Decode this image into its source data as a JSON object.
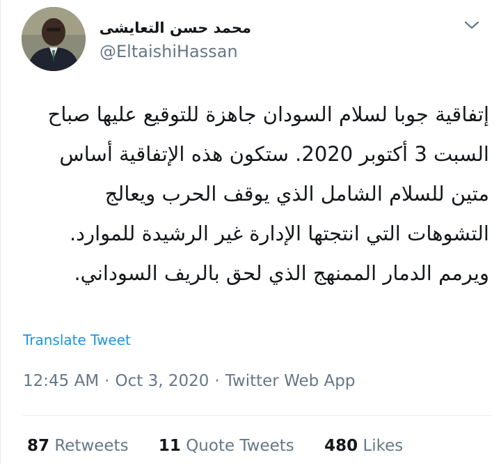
{
  "tweet": {
    "author": {
      "display_name": "محمد حسن التعايشى",
      "handle": "@EltaishiHassan",
      "avatar_icon": "profile-photo"
    },
    "menu_icon": "chevron-down-icon",
    "text": "إتفاقية جوبا لسلام السودان جاهزة للتوقيع عليها صباح السبت 3 أكتوبر 2020. ستكون هذه الإتفاقية أساس متين للسلام الشامل الذي يوقف الحرب ويعالج التشوهات التي انتجتها الإدارة غير الرشيدة للموارد. ويرمم الدمار الممنهج الذي لحق بالريف السوداني.",
    "translate_label": "Translate Tweet",
    "time": "12:45 AM",
    "date": "Oct 3, 2020",
    "source": "Twitter Web App",
    "separator": "·",
    "stats": {
      "retweets_count": "87",
      "retweets_label": "Retweets",
      "quote_count": "11",
      "quote_label": "Quote Tweets",
      "likes_count": "480",
      "likes_label": "Likes"
    }
  },
  "colors": {
    "link": "#1b95e0",
    "secondary_text": "#657786",
    "primary_text": "#14171a",
    "border": "#e6ecf0"
  }
}
